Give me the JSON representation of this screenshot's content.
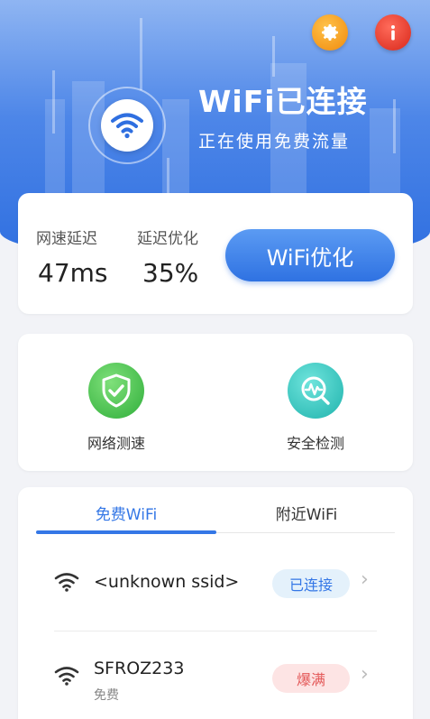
{
  "header": {
    "title": "WiFi已连接",
    "subtitle": "正在使用免费流量",
    "settings_icon": "gear-icon",
    "info_icon": "info-icon",
    "colors": {
      "top": "#8fb5f2",
      "bottom": "#2f6fe0"
    }
  },
  "metrics": {
    "latency_label": "网速延迟",
    "latency_value": "47ms",
    "optimize_label": "延迟优化",
    "optimize_value": "35%",
    "button_label": "WiFi优化"
  },
  "tools": [
    {
      "label": "网络测速",
      "icon": "shield-check-icon",
      "color": "#2fae3a"
    },
    {
      "label": "安全检测",
      "icon": "magnifier-icon",
      "color": "#1fb3ad"
    }
  ],
  "tabs": {
    "free": "免费WiFi",
    "nearby": "附近WiFi",
    "active": "free"
  },
  "networks": [
    {
      "name": "<unknown ssid>",
      "sub": "",
      "badge": "已连接",
      "badge_color": "#3477e6"
    },
    {
      "name": "SFROZ233",
      "sub": "免费",
      "badge": "爆满",
      "badge_color": "#e45a5a"
    }
  ]
}
